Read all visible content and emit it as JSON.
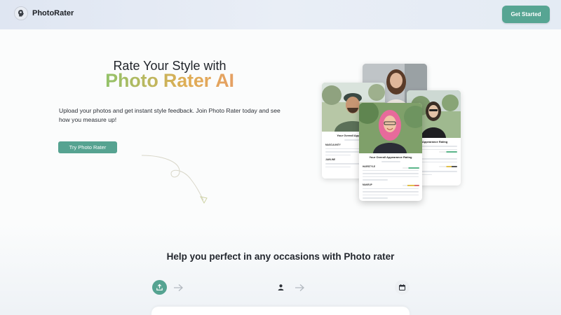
{
  "header": {
    "brand": "PhotoRater",
    "logo_icon": "head-silhouette-icon",
    "cta_label": "Get Started"
  },
  "hero": {
    "title": "Rate Your Style with",
    "gradient_title": "Photo Rater AI",
    "description": "Upload your photos and get instant style feedback. Join Photo Rater today and see how you measure up!",
    "cta_label": "Try Photo Rater"
  },
  "cards": {
    "left_title": "Your Overall Appearance",
    "right_title": "ll Appearance Rating",
    "front_title": "Your Overall Appearance Rating",
    "front_labels": [
      "HAIRSTYLE",
      "MAKEUP"
    ],
    "left_labels": [
      "MASCULINITY",
      "JAWLINE"
    ]
  },
  "colors": {
    "accent": "#56a391",
    "rating_green": "#5bb58a",
    "rating_yellow": "#e2c04a",
    "rating_red": "#dc6f6f"
  },
  "steps": {
    "heading": "Help you perfect in any occasions with Photo rater",
    "items": [
      {
        "icon": "upload-icon",
        "active": true
      },
      {
        "icon": "user-icon",
        "active": false
      },
      {
        "icon": "calendar-icon",
        "active": false
      }
    ],
    "arrow_icon": "arrow-right-icon"
  }
}
